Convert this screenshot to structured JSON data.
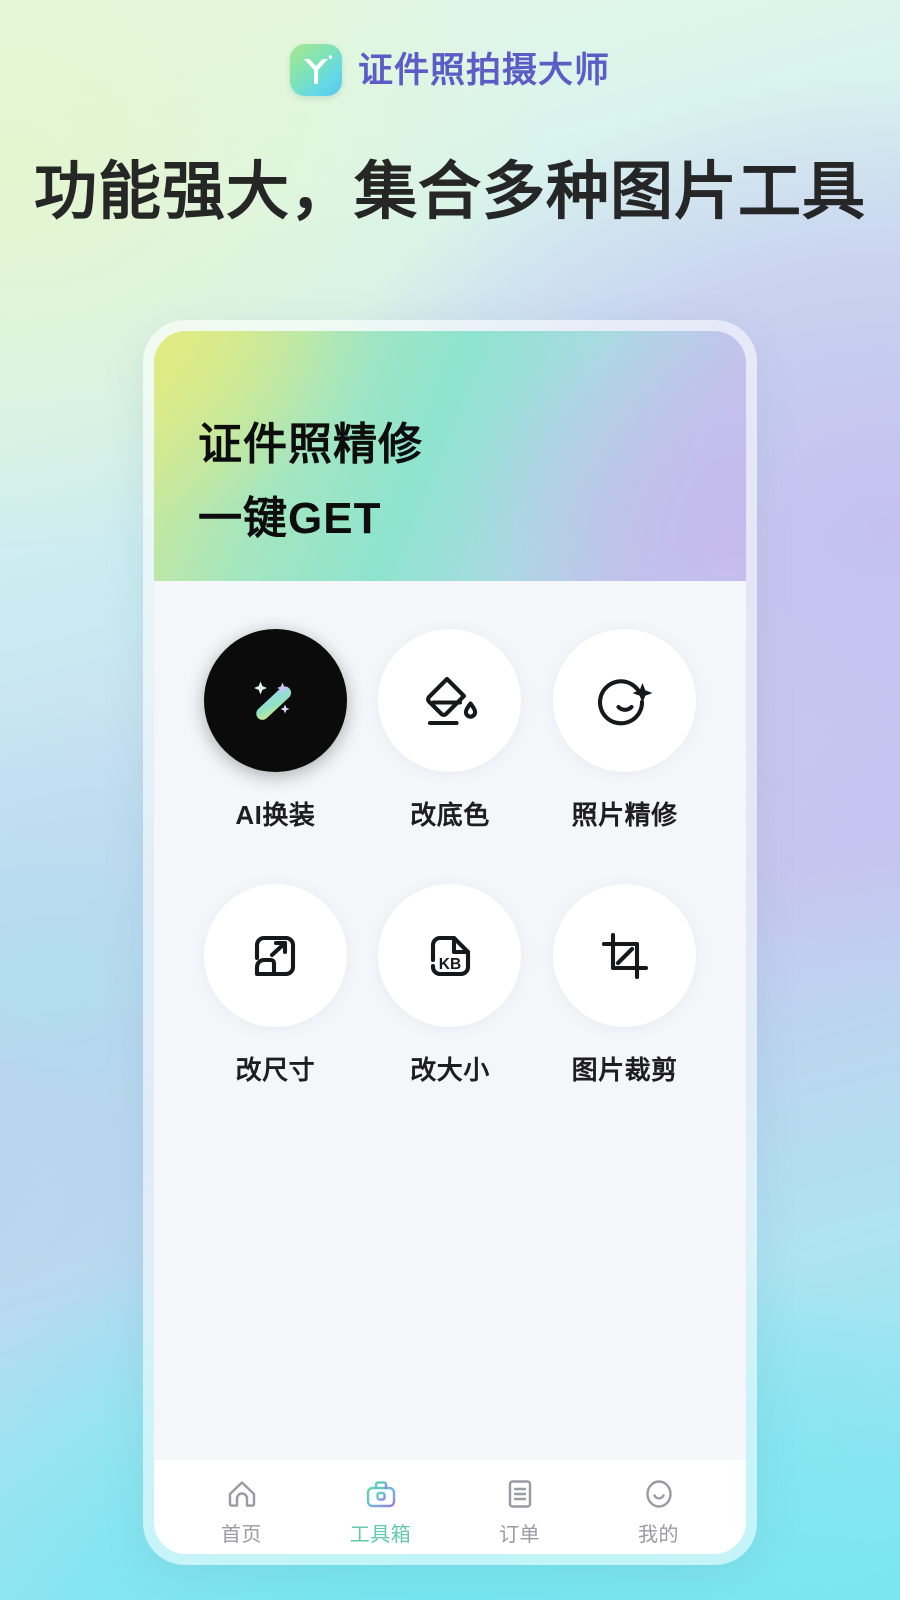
{
  "brand": {
    "icon": "app-logo-icon",
    "title": "证件照拍摄大师"
  },
  "headline": "功能强大，集合多种图片工具",
  "hero": {
    "line1": "证件照精修",
    "line2": "一键GET"
  },
  "tools": [
    {
      "label": "AI换装",
      "icon": "magic-wand-icon",
      "style": "dark"
    },
    {
      "label": "改底色",
      "icon": "paint-bucket-icon",
      "style": "light"
    },
    {
      "label": "照片精修",
      "icon": "face-sparkle-icon",
      "style": "light"
    },
    {
      "label": "改尺寸",
      "icon": "resize-icon",
      "style": "light"
    },
    {
      "label": "改大小",
      "icon": "file-kb-icon",
      "style": "light"
    },
    {
      "label": "图片裁剪",
      "icon": "crop-icon",
      "style": "light"
    }
  ],
  "tool_icon_text": {
    "kb": "KB"
  },
  "tabs": [
    {
      "label": "首页",
      "icon": "home-icon",
      "active": false
    },
    {
      "label": "工具箱",
      "icon": "toolbox-icon",
      "active": true
    },
    {
      "label": "订单",
      "icon": "order-icon",
      "active": false
    },
    {
      "label": "我的",
      "icon": "profile-icon",
      "active": false
    }
  ],
  "colors": {
    "brand_text": "#5d5cc6",
    "headline_text": "#262626",
    "tab_active": "#62c7ad",
    "tab_inactive": "#9a9aa2",
    "tool_dark_bg": "#0b0b0b",
    "tool_light_bg": "#ffffff",
    "screen_bg": "#f5f6fa",
    "page_bg_top": "#e6f8e2",
    "page_bg_mid": "#c7c9ef",
    "page_bg_bottom": "#79e6f1"
  }
}
